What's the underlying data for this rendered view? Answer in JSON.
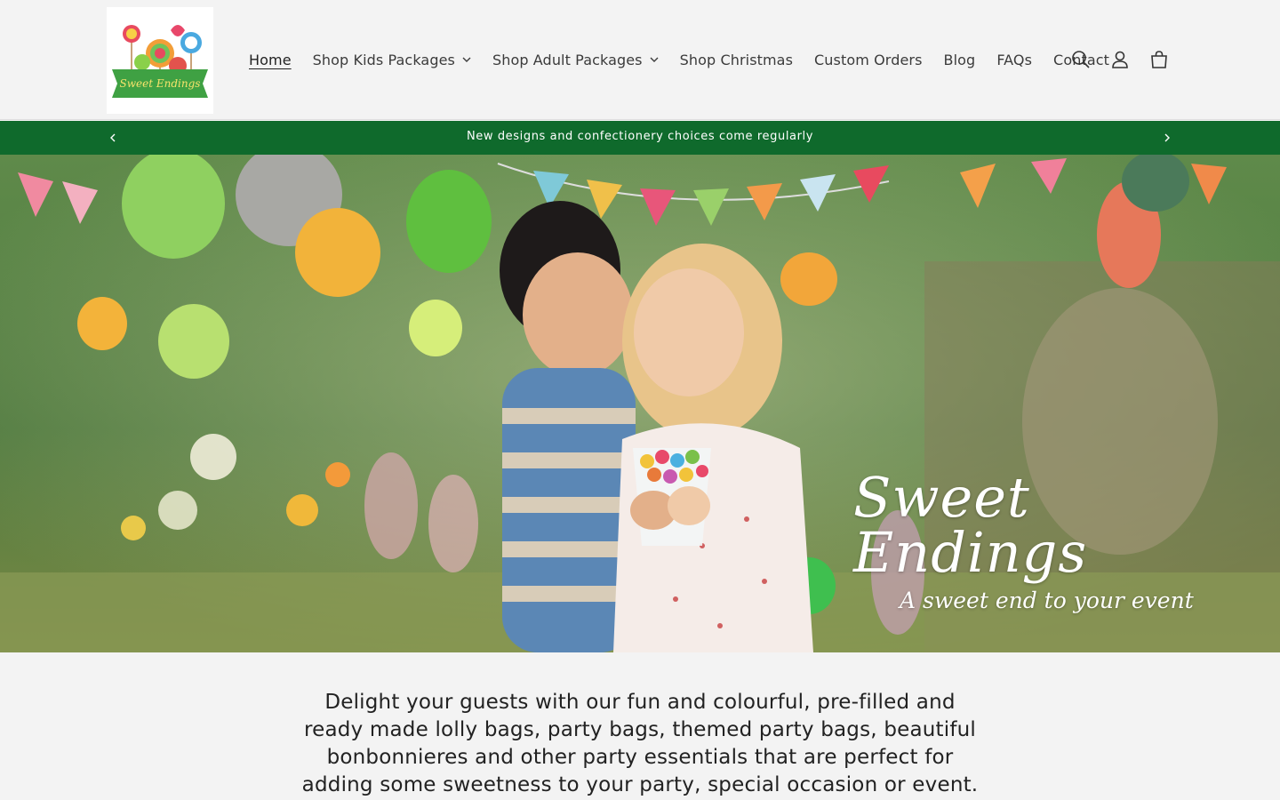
{
  "header": {
    "logo_alt": "Sweet Endings",
    "nav": [
      {
        "label": "Home",
        "active": true,
        "dropdown": false
      },
      {
        "label": "Shop Kids Packages",
        "active": false,
        "dropdown": true
      },
      {
        "label": "Shop Adult Packages",
        "active": false,
        "dropdown": true
      },
      {
        "label": "Shop Christmas",
        "active": false,
        "dropdown": false
      },
      {
        "label": "Custom Orders",
        "active": false,
        "dropdown": false
      },
      {
        "label": "Blog",
        "active": false,
        "dropdown": false
      },
      {
        "label": "FAQs",
        "active": false,
        "dropdown": false
      },
      {
        "label": "Contact",
        "active": false,
        "dropdown": false
      }
    ],
    "icons": [
      "search-icon",
      "account-icon",
      "cart-icon"
    ]
  },
  "announcement": {
    "text": "New designs and confectionery choices come regularly",
    "bg_color": "#0f6a2c"
  },
  "hero": {
    "brand_name": "Sweet Endings",
    "tagline": "A sweet end to your event"
  },
  "intro": {
    "text": "Delight your guests with our fun and colourful, pre-filled and ready made lolly bags, party bags, themed party bags, beautiful bonbonnieres and other party essentials that are perfect for adding some sweetness to your party, special occasion or event."
  }
}
